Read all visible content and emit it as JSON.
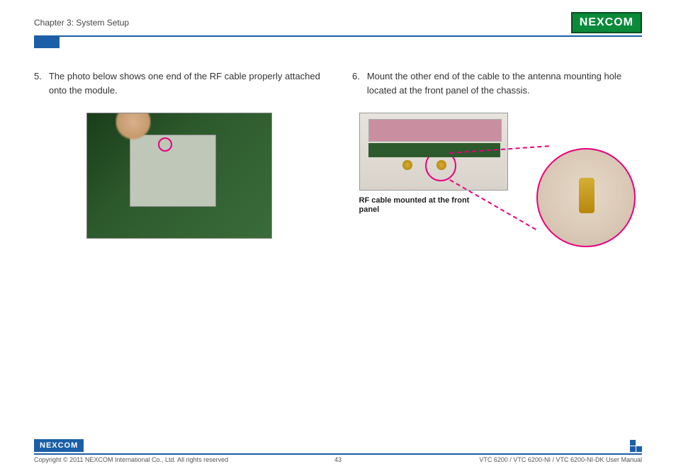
{
  "header": {
    "chapter": "Chapter 3: System Setup",
    "brand": "NEXCOM"
  },
  "steps": {
    "left": {
      "num": "5.",
      "text": "The photo below shows one end of the RF cable properly attached onto the module."
    },
    "right": {
      "num": "6.",
      "text": "Mount the other end of the cable to the antenna mounting hole located at the front panel of the chassis."
    }
  },
  "caption": {
    "rf_mounted": "RF cable mounted at the front panel"
  },
  "footer": {
    "brand": "NEXCOM",
    "copyright": "Copyright © 2011 NEXCOM International Co., Ltd. All rights reserved",
    "page": "43",
    "docref": "VTC 6200 / VTC 6200-NI / VTC 6200-NI-DK User Manual"
  }
}
